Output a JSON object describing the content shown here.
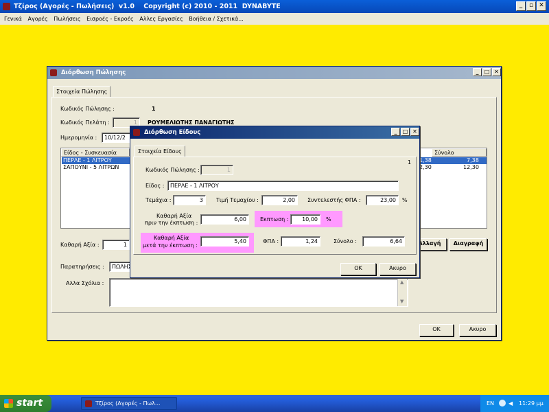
{
  "app": {
    "title": "Τζίρος (Αγορές - Πωλήσεις)  v1.0    Copyright (c) 2010 - 2011  DYNABYTE",
    "controls": {
      "minimize": "_",
      "restore": "▫",
      "close": "✕"
    }
  },
  "menu": [
    "Γενικά",
    "Αγορές",
    "Πωλήσεις",
    "Εισροές - Εκροές",
    "Αλλες Εργασίες",
    "Βοήθεια / Σχετικά..."
  ],
  "sale_window": {
    "title": "Διόρθωση Πώλησης",
    "tab": "Στοιχεία Πώλησης",
    "sale_code_label": "Κωδικός Πώλησης :",
    "sale_code_value": "1",
    "customer_code_label": "Κωδικός Πελάτη :",
    "customer_code_value": "1",
    "customer_name": "ΡΟΥΜΕΛΙΩΤΗΣ ΠΑΝΑΓΙΩΤΗΣ",
    "date_label": "Ημερομηνία :",
    "date_value": "10/12/2",
    "list_col_item": "Είδος - Συσκευασία",
    "list_col_total": "Σύνολο",
    "items": [
      {
        "name": "ΠΕΡΛΕ - 1 ΛΙΤΡΟΥ",
        "mid": "1,38",
        "total": "7,38"
      },
      {
        "name": "ΣΑΠΟΥΝΙ - 5 ΛΙΤΡΩΝ",
        "mid": "2,30",
        "total": "12,30"
      }
    ],
    "net_label": "Καθαρή Αξία :",
    "net_value": "1",
    "change_button": "Αλλαγή",
    "delete_button": "Διαγραφή",
    "notes_label": "Παρατηρήσεις :",
    "notes_value": "ΠΩΛΗΣ",
    "other_comments_label": "Αλλα Σχόλια :",
    "ok_button": "OK",
    "cancel_button": "Ακυρο"
  },
  "item_window": {
    "title": "Διόρθωση Είδους",
    "tab": "Στοιχεία Είδους",
    "corner_number": "1",
    "sale_code_label": "Κωδικός Πώλησης :",
    "sale_code_value": "1",
    "item_label": "Είδος :",
    "item_value": "ΠΕΡΛΕ - 1 ΛΙΤΡΟΥ",
    "qty_label": "Τεμάχια :",
    "qty_value": "3",
    "unit_price_label": "Τιμή Τεμαχίου :",
    "unit_price_value": "2,00",
    "vat_rate_label": "Συντελεστής ΦΠΑ :",
    "vat_rate_value": "23,00",
    "vat_rate_unit": "%",
    "net_before_label_1": "Καθαρή Αξία",
    "net_before_label_2": "πριν την έκπτωση :",
    "net_before_value": "6,00",
    "discount_label": "Εκπτωση :",
    "discount_value": "10,00",
    "discount_unit": "%",
    "net_after_label_1": "Καθαρή Αξία",
    "net_after_label_2": "μετά την έκπτωση :",
    "net_after_value": "5,40",
    "vat_label": "ΦΠΑ :",
    "vat_value": "1,24",
    "total_label": "Σύνολο :",
    "total_value": "6,64",
    "ok_button": "OK",
    "cancel_button": "Ακυρο"
  },
  "taskbar": {
    "start": "start",
    "task": "Τζίρος (Αγορές - Πωλ...",
    "lang": "EN",
    "clock": "11:29 μμ"
  }
}
